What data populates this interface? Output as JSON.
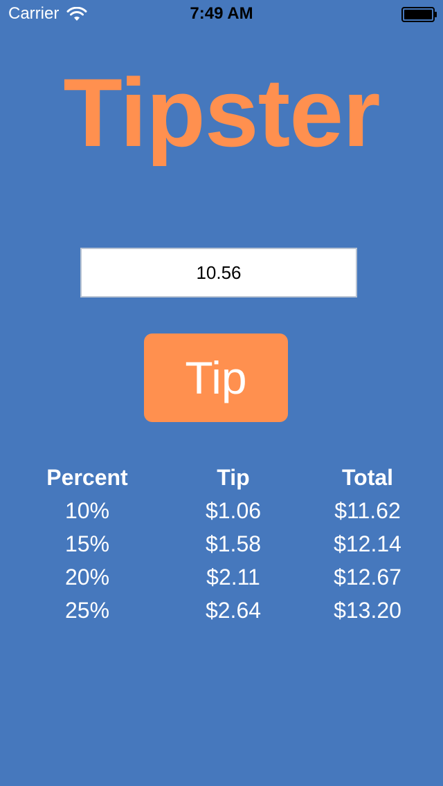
{
  "status_bar": {
    "carrier": "Carrier",
    "time": "7:49 AM",
    "wifi_icon": "wifi-icon",
    "battery_icon": "battery-icon"
  },
  "app": {
    "title": "Tipster",
    "title_color": "#ff904f",
    "background_color": "#4678bd"
  },
  "amount_input": {
    "value": "10.56"
  },
  "tip_button": {
    "label": "Tip",
    "color": "#ff904f"
  },
  "results": {
    "headers": [
      "Percent",
      "Tip",
      "Total"
    ],
    "rows": [
      [
        "10%",
        "$1.06",
        "$11.62"
      ],
      [
        "15%",
        "$1.58",
        "$12.14"
      ],
      [
        "20%",
        "$2.11",
        "$12.67"
      ],
      [
        "25%",
        "$2.64",
        "$13.20"
      ]
    ]
  }
}
